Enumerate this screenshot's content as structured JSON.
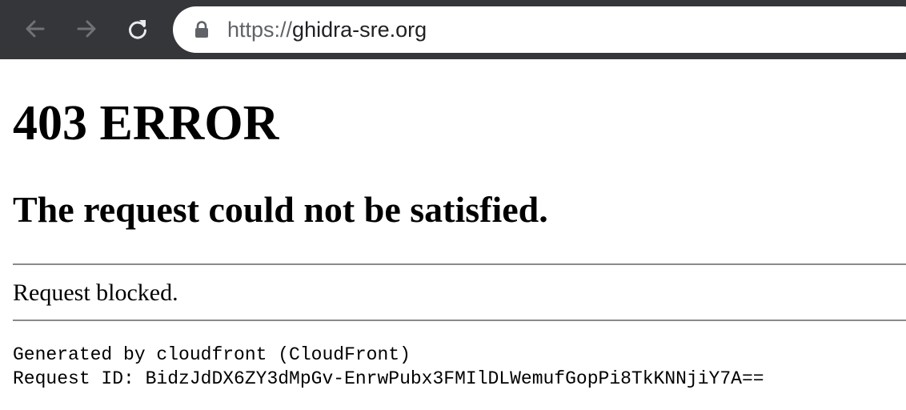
{
  "browser": {
    "url_scheme": "https://",
    "url_host": "ghidra-sre.org",
    "icons": {
      "back": "back-arrow-icon",
      "forward": "forward-arrow-icon",
      "reload": "reload-icon",
      "lock": "lock-icon"
    },
    "colors": {
      "toolbar": "#35363a",
      "omnibox": "#ffffff"
    }
  },
  "page": {
    "error_title": "403 ERROR",
    "error_subtitle": "The request could not be satisfied.",
    "message": "Request blocked.",
    "generated_by": "Generated by cloudfront (CloudFront)",
    "request_id_line": "Request ID: BidzJdDX6ZY3dMpGv-EnrwPubx3FMIlDLWemufGopPi8TkKNNjiY7A=="
  }
}
